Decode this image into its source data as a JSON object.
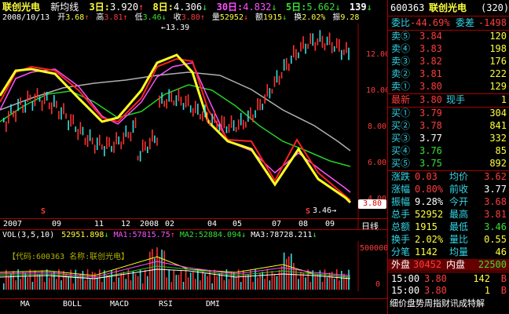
{
  "header": {
    "stock_name": "联创光电",
    "mode": "新均线",
    "ma_items": [
      {
        "label": "3日:",
        "value": "3.920",
        "arrow": "↑"
      },
      {
        "label": "8日:",
        "value": "4.306",
        "arrow": "↓"
      },
      {
        "label": "30日:",
        "value": "4.832",
        "arrow": "↓"
      },
      {
        "label": "5日:",
        "value": "5.662",
        "arrow": "↓"
      },
      {
        "label": "",
        "value": "139",
        "arrow": "↓"
      }
    ],
    "ohlc_line": {
      "date": "2008/10/13",
      "open_label": "开",
      "open": "3.68",
      "high_label": "高",
      "high": "3.81",
      "low_label": "低",
      "low": "3.46",
      "close_label": "收",
      "close": "3.80",
      "vol_label": "量",
      "vol": "52952",
      "amt_label": "额",
      "amt": "1915",
      "turn_label": "换",
      "turn": "2.02%",
      "amp_label": "振",
      "amp": "9.28"
    }
  },
  "chart": {
    "price_axis": [
      "12.00",
      "10.00",
      "8.00",
      "6.00",
      "4.00"
    ],
    "peak_label": "13.39",
    "low_label": "3.46",
    "current_price_tag": "3.80",
    "x_labels": [
      "2007",
      "09",
      "11",
      "12",
      "2008",
      "02",
      "04",
      "05",
      "07",
      "08",
      "09"
    ],
    "period": "日线",
    "s_markers": [
      "S",
      "S"
    ]
  },
  "volume": {
    "title": "VOL(3,5,10)",
    "items": [
      {
        "label": "",
        "value": "52951.898",
        "arrow": "↓",
        "color": "#ffff3c"
      },
      {
        "label": "MA1:",
        "value": "57815.75",
        "arrow": "↑",
        "color": "#ff50ff"
      },
      {
        "label": "MA2:",
        "value": "52884.094",
        "arrow": "↓",
        "color": "#35e035"
      },
      {
        "label": "MA3:",
        "value": "78728.211",
        "arrow": "↓",
        "color": "#ffffff"
      }
    ],
    "code_text": "【代码:600363 名称:联创光电】",
    "axis": [
      "500000",
      "0"
    ]
  },
  "tabs": [
    "MA",
    "BOLL",
    "MACD",
    "RSI",
    "DMI"
  ],
  "panel": {
    "code": "600363",
    "name": "联创光电",
    "num": "(320)",
    "weibi_label": "委比",
    "weibi": "-44.69%",
    "weicha_label": "委差",
    "weicha": "-1498",
    "sells": [
      {
        "label": "卖⑤",
        "price": "3.84",
        "vol": "120"
      },
      {
        "label": "卖④",
        "price": "3.83",
        "vol": "198"
      },
      {
        "label": "卖③",
        "price": "3.82",
        "vol": "176"
      },
      {
        "label": "卖②",
        "price": "3.81",
        "vol": "222"
      },
      {
        "label": "卖①",
        "price": "3.80",
        "vol": "129"
      }
    ],
    "latest_label": "最新",
    "latest": "3.80",
    "xianshou_label": "现手",
    "xianshou": "1",
    "buys": [
      {
        "label": "买①",
        "price": "3.79",
        "vol": "304"
      },
      {
        "label": "买②",
        "price": "3.78",
        "vol": "841"
      },
      {
        "label": "买③",
        "price": "3.77",
        "vol": "332"
      },
      {
        "label": "买④",
        "price": "3.76",
        "vol": "85"
      },
      {
        "label": "买⑤",
        "price": "3.75",
        "vol": "892"
      }
    ],
    "stats": [
      {
        "l1": "涨跌",
        "v1": "0.03",
        "l2": "均价",
        "v2": "3.62"
      },
      {
        "l1": "涨幅",
        "v1": "0.80%",
        "l2": "前收",
        "v2": "3.77"
      },
      {
        "l1": "振幅",
        "v1": "9.28%",
        "l2": "今开",
        "v2": "3.68"
      },
      {
        "l1": "总手",
        "v1": "52952",
        "l2": "最高",
        "v2": "3.81"
      },
      {
        "l1": "总额",
        "v1": "1915",
        "l2": "最低",
        "v2": "3.46"
      },
      {
        "l1": "换手",
        "v1": "2.02%",
        "l2": "量比",
        "v2": "0.55"
      },
      {
        "l1": "分笔",
        "v1": "1142",
        "l2": "均量",
        "v2": "46"
      }
    ],
    "waipan_label": "外盘",
    "waipan": "30452",
    "neipan_label": "内盘",
    "neipan": "22500",
    "ticks": [
      {
        "time": "15:00",
        "price": "3.80",
        "vol": "142",
        "dir": "B"
      },
      {
        "time": "15:00",
        "price": "3.80",
        "vol": "1",
        "dir": "B"
      }
    ],
    "bottom_text": "细价盘势周指财讯成特解"
  }
}
